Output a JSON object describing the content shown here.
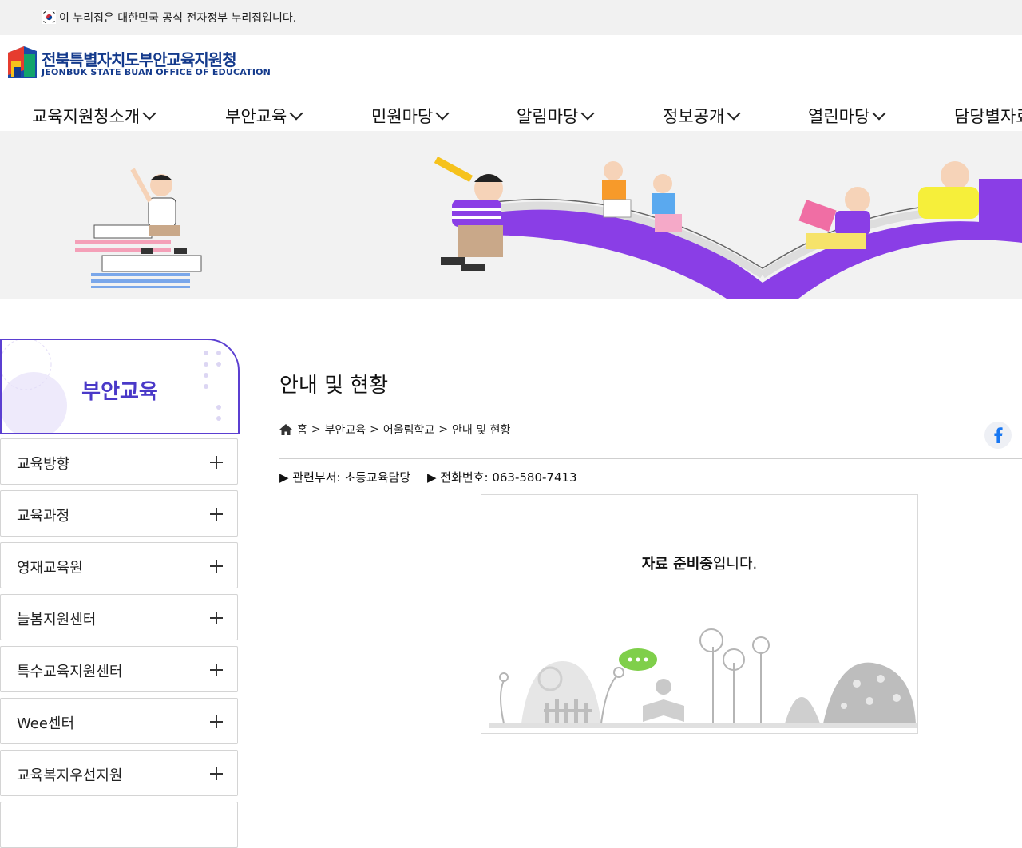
{
  "gov_banner": {
    "text": "이 누리집은 대한민국 공식 전자정부 누리집입니다."
  },
  "logo": {
    "name_ko": "전북특별자치도부안교육지원청",
    "name_en": "JEONBUK STATE BUAN OFFICE OF EDUCATION"
  },
  "gnb": {
    "items": [
      "교육지원청소개",
      "부안교육",
      "민원마당",
      "알림마당",
      "정보공개",
      "열린마당",
      "담당별자료실"
    ]
  },
  "lnb": {
    "title": "부안교육",
    "items": [
      "교육방향",
      "교육과정",
      "영재교육원",
      "늘봄지원센터",
      "특수교육지원센터",
      "Wee센터",
      "교육복지우선지원"
    ]
  },
  "content": {
    "title": "안내 및 현황",
    "breadcrumb": {
      "home": "홈",
      "sep": ">",
      "level1": "부안교육",
      "level2": "어울림학교",
      "current": "안내 및 현황"
    },
    "dept": "▶ 관련부서: 초등교육담당",
    "phone": "▶ 전화번호: 063-580-7413",
    "prep_bold": "자료 준비중",
    "prep_rest": "입니다."
  },
  "colors": {
    "accent": "#5b3fd1",
    "logo_blue": "#143a8c",
    "facebook": "#1877f2"
  }
}
